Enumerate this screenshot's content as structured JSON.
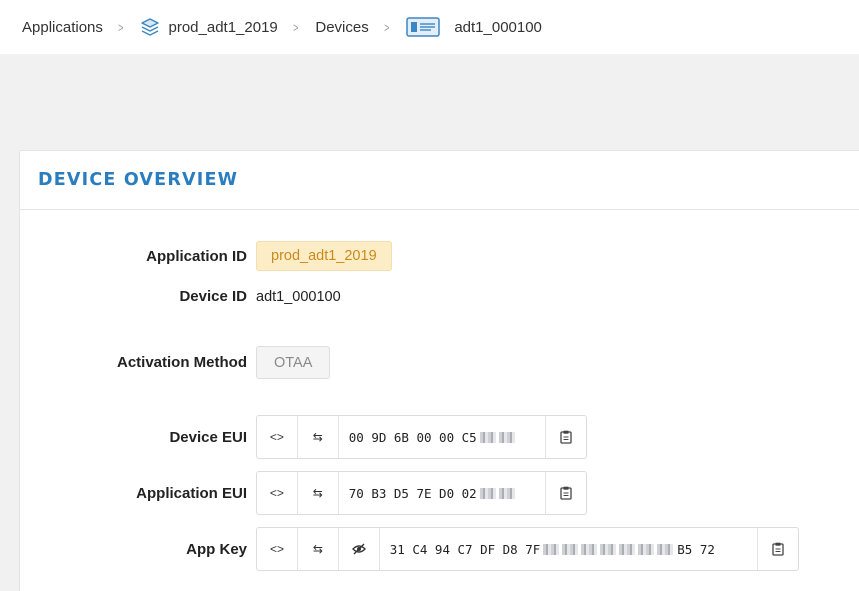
{
  "breadcrumb": {
    "applications": "Applications",
    "application": "prod_adt1_2019",
    "devices": "Devices",
    "device": "adt1_000100"
  },
  "card": {
    "title": "DEVICE OVERVIEW"
  },
  "fields": {
    "application_id": {
      "label": "Application ID",
      "value": "prod_adt1_2019"
    },
    "device_id": {
      "label": "Device ID",
      "value": "adt1_000100"
    },
    "activation_method": {
      "label": "Activation Method",
      "value": "OTAA"
    },
    "device_eui": {
      "label": "Device EUI",
      "value": "00 9D 6B 00 00 C5"
    },
    "application_eui": {
      "label": "Application EUI",
      "value": "70 B3 D5 7E D0 02"
    },
    "app_key": {
      "label": "App Key",
      "value_start": "31 C4 94 C7 DF D8 7F",
      "value_end": "B5 72"
    }
  },
  "colors": {
    "accent": "#2a7dbf",
    "app_tag_bg": "#fdedc6",
    "app_tag_text": "#c98a1e"
  },
  "icons": [
    "chevron-right-icon",
    "layers-icon",
    "device-icon",
    "code-icon",
    "swap-icon",
    "eye-slash-icon",
    "clipboard-icon"
  ]
}
